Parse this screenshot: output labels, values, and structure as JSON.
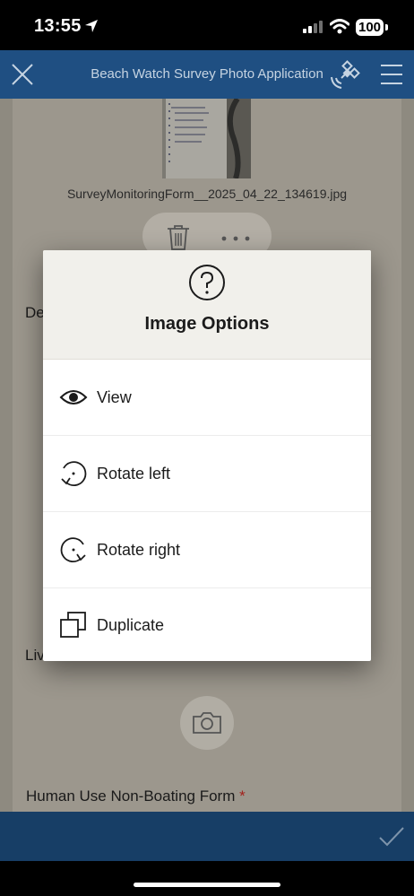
{
  "status": {
    "time": "13:55",
    "battery": "100"
  },
  "app": {
    "title": "Beach Watch Survey Photo Application"
  },
  "form": {
    "filename": "SurveyMonitoringForm__2025_04_22_134619.jpg",
    "label_partial_1": "De",
    "label_partial_2": "Liv",
    "human_use_label": "Human Use Non-Boating Form",
    "required_marker": "*"
  },
  "modal": {
    "title": "Image Options",
    "options": [
      {
        "label": "View",
        "icon": "eye-icon"
      },
      {
        "label": "Rotate left",
        "icon": "rotate-left-icon"
      },
      {
        "label": "Rotate right",
        "icon": "rotate-right-icon"
      },
      {
        "label": "Duplicate",
        "icon": "duplicate-icon"
      }
    ]
  },
  "colors": {
    "app_bar": "#1f4f82",
    "bottom_bar": "#173e66",
    "required": "#a3211c",
    "modal_header": "#f1f0eb"
  }
}
